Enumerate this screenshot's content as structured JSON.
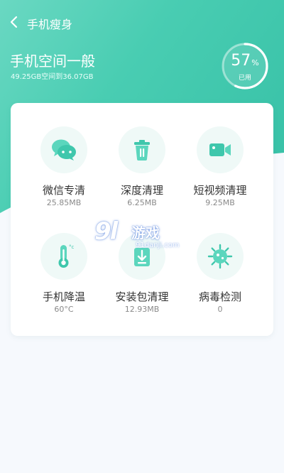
{
  "header": {
    "title": "手机瘦身"
  },
  "storage": {
    "title": "手机空间一般",
    "summary": "49.25GB空间到36.07GB",
    "percent_value": "57",
    "percent_unit": "%",
    "percent_label": "已用",
    "used_fraction": 0.57
  },
  "tools": [
    {
      "label": "微信专清",
      "value": "25.85MB",
      "icon": "wechat-icon"
    },
    {
      "label": "深度清理",
      "value": "6.25MB",
      "icon": "trash-icon"
    },
    {
      "label": "短视频清理",
      "value": "9.25MB",
      "icon": "video-camera-icon"
    },
    {
      "label": "手机降温",
      "value": "60°C",
      "icon": "thermometer-icon"
    },
    {
      "label": "安装包清理",
      "value": "12.93MB",
      "icon": "package-icon"
    },
    {
      "label": "病毒检测",
      "value": "0",
      "icon": "virus-icon"
    }
  ],
  "watermark": {
    "logo": "9l",
    "text": "游戏",
    "url": "91danji.com"
  },
  "colors": {
    "accent": "#3fc7ac",
    "icon_bg": "#eff9f7",
    "background": "#f6f9fd"
  }
}
